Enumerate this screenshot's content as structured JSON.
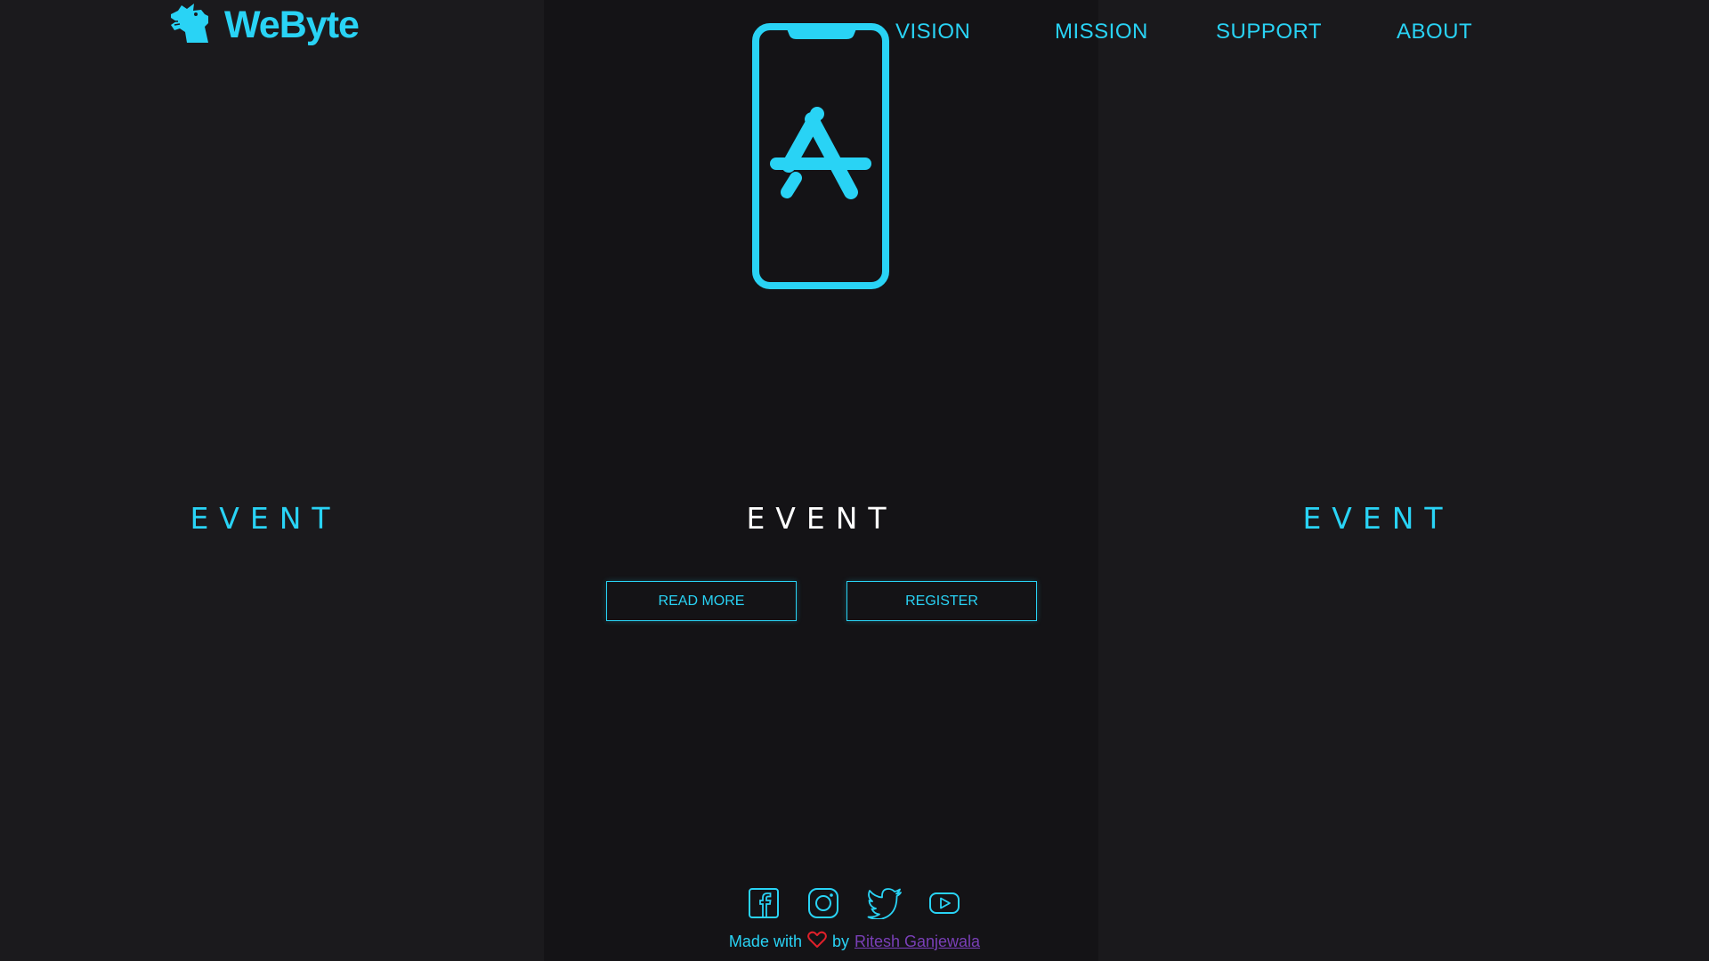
{
  "brand": {
    "name": "WeByte",
    "logo_icon": "dragon-head-icon",
    "accent_color": "#29d3f5"
  },
  "nav": {
    "items": [
      {
        "label": "VISION"
      },
      {
        "label": "MISSION"
      },
      {
        "label": "SUPPORT"
      },
      {
        "label": "ABOUT"
      }
    ]
  },
  "hero": {
    "icon": "app-store-phone-icon"
  },
  "events": [
    {
      "title": "EVENT",
      "color": "#29d3f5"
    },
    {
      "title": "EVENT",
      "color": "#ffffff"
    },
    {
      "title": "EVENT",
      "color": "#29d3f5"
    }
  ],
  "actions": {
    "read_more_label": "READ MORE",
    "register_label": "REGISTER"
  },
  "social": {
    "icons": [
      "facebook-icon",
      "instagram-icon",
      "twitter-icon",
      "youtube-icon"
    ]
  },
  "footer": {
    "made_with": "Made with",
    "heart_icon": "heart-icon",
    "heart_color": "#e0202a",
    "by": "by",
    "author": "Ritesh Ganjewala",
    "author_color": "#7a3fb8"
  }
}
